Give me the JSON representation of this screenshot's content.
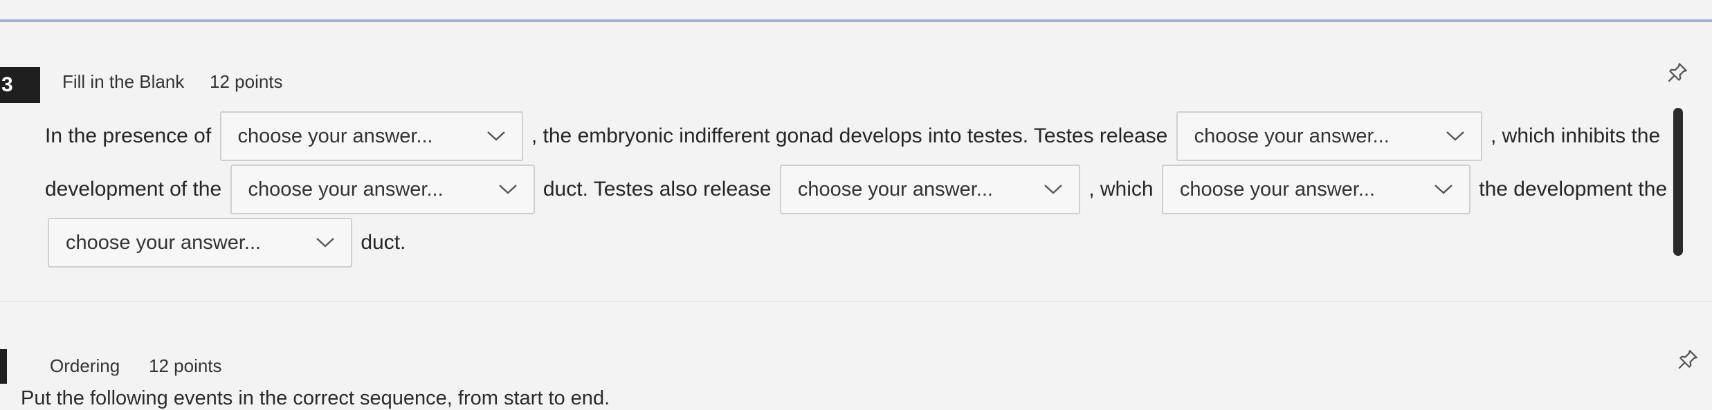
{
  "question3": {
    "number": "3",
    "type": "Fill in the Blank",
    "points": "12 points",
    "text": {
      "t1": "In the presence of",
      "t2": ", the embryonic indifferent gonad develops into testes. Testes release",
      "t3": ", which inhibits the development of the",
      "t4": "duct. Testes also release",
      "t5": ", which",
      "t6": "the development the",
      "t7": "duct."
    },
    "dropdowns": [
      {
        "selected": "choose your answer..."
      },
      {
        "selected": "choose your answer..."
      },
      {
        "selected": "choose your answer..."
      },
      {
        "selected": "choose your answer..."
      },
      {
        "selected": "choose your answer..."
      },
      {
        "selected": "choose your answer..."
      }
    ],
    "pin_icon": "pin-icon"
  },
  "question4": {
    "type": "Ordering",
    "points": "12 points",
    "instructions": "Put the following events in the correct sequence, from start to end.",
    "pin_icon": "pin-icon"
  }
}
